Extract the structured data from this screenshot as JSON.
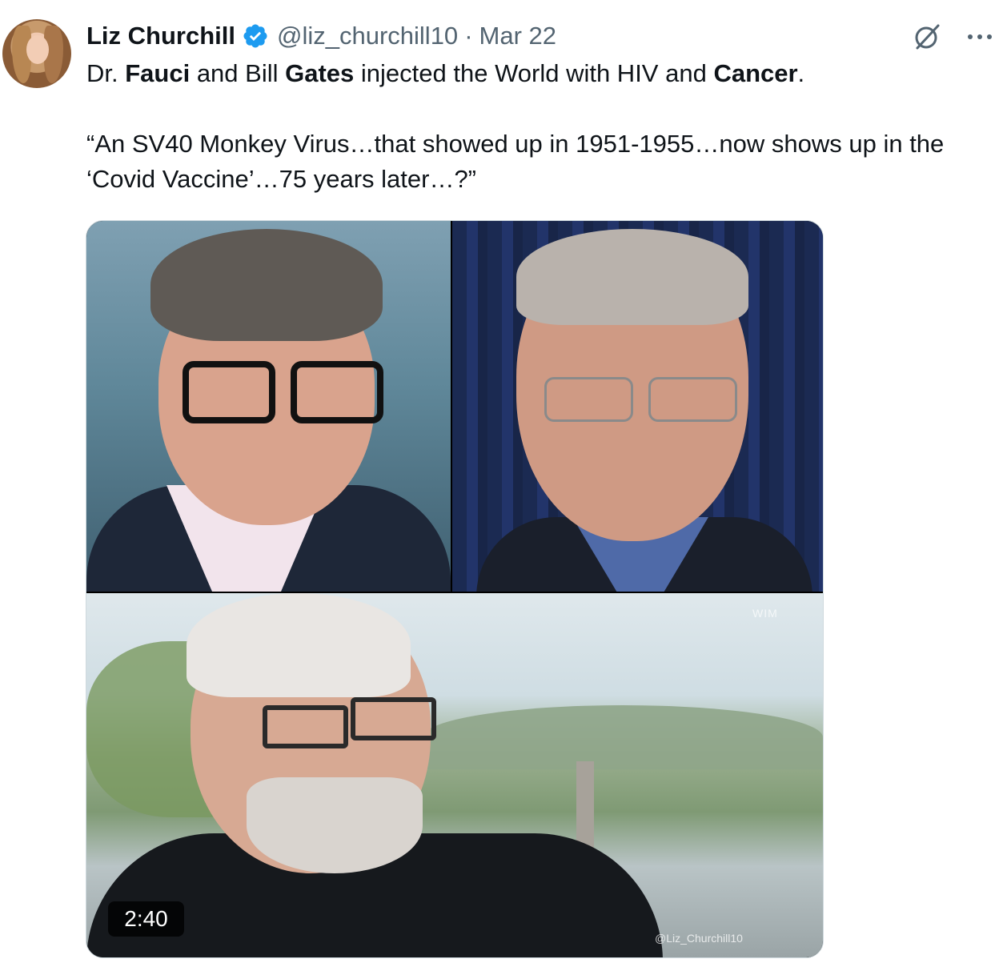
{
  "author": {
    "name": "Liz Churchill",
    "handle": "@liz_churchill10",
    "separator": "·",
    "date": "Mar 22",
    "verified": true,
    "verified_color": "#1d9bf0"
  },
  "icons": {
    "verified": "verified-badge-icon",
    "grok": "grok-icon",
    "more": "more-options-icon"
  },
  "tweet": {
    "line1": {
      "t1": "Dr. ",
      "b1": "Fauci",
      "t2": " and Bill ",
      "b2": "Gates",
      "t3": " injected the World with HIV and ",
      "b3": "Cancer",
      "t4": "."
    },
    "quote": "“An SV40 Monkey Virus…that showed up in 1951-1955…now shows up in the ‘Covid Vaccine’…75 years later…?”"
  },
  "media": {
    "type": "video",
    "duration": "2:40",
    "watermark": "@Liz_Churchill10",
    "corner_logo": "WIM"
  }
}
